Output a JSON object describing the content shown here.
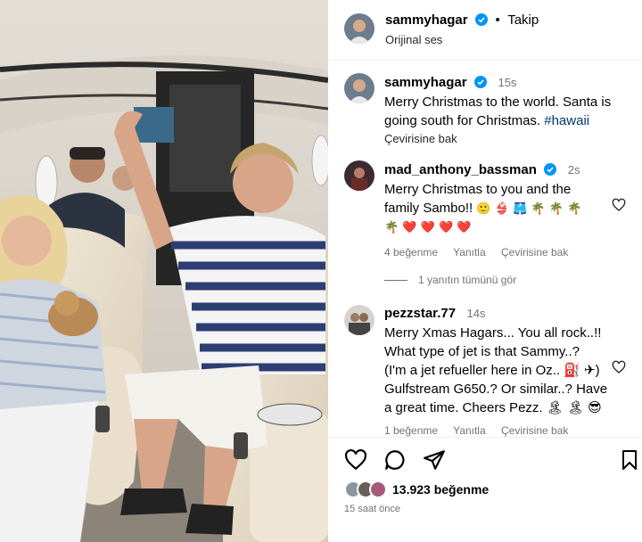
{
  "post": {
    "author": "sammyhagar",
    "follow": "Takip",
    "dot": "•",
    "audio": "Orijinal ses",
    "caption_time": "15s",
    "caption_text": "Merry Christmas to the world. Santa is going south for Christmas.",
    "caption_tag": "#hawaii",
    "see_translation": "Çevirisine bak",
    "likes": "13.923 beğenme",
    "ago": "15 saat önce"
  },
  "comments": [
    {
      "user": "mad_anthony_bassman",
      "time": "2s",
      "line1": "Merry Christmas to you and the",
      "line2": "family Sambo!!",
      "emoji_line2": "🙂 👙 🩳 🌴 🌴 🌴",
      "emoji_line3": "🌴 ❤️ ❤️ ❤️ ❤️",
      "likes": "4 beğenme",
      "reply": "Yanıtla",
      "translate": "Çevirisine bak",
      "view_replies": "1 yanıtın tümünü gör"
    },
    {
      "user": "pezzstar.77",
      "time": "14s",
      "line1": "Merry Xmas Hagars... You all rock..!!",
      "line2": "What type of jet is that Sammy..?",
      "line3": "(I'm a jet refueller here in Oz.. ⛽ ✈)",
      "line4": "Gulfstream G650.? Or similar..? Have",
      "line5": "a great time. Cheers Pezz. 🏝 🏝 😎",
      "likes": "1 beğenme",
      "reply": "Yanıtla",
      "translate": "Çevirisine bak"
    }
  ],
  "icons": {
    "heart": "heart-icon",
    "comment": "comment-icon",
    "share": "share-icon",
    "save": "bookmark-icon",
    "verified": "verified-badge-icon"
  },
  "colors": {
    "verified": "#0095f6",
    "link": "#00376b",
    "muted": "#737373"
  }
}
